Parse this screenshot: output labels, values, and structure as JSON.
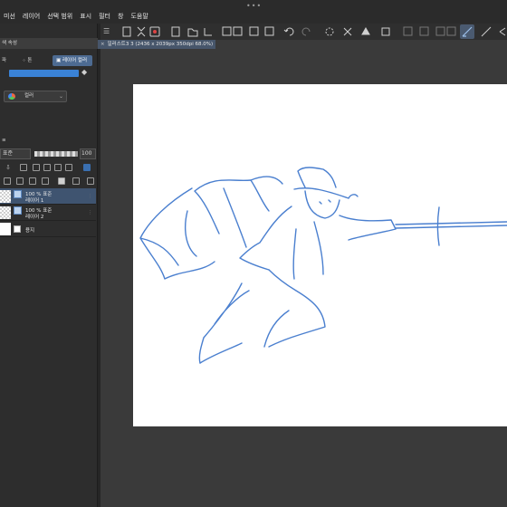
{
  "menubar": {
    "items": [
      "미선",
      "레이어",
      "선택 범위",
      "표시",
      "필터",
      "창",
      "도움말"
    ]
  },
  "window_controls": "•••",
  "left_panel": {
    "title": "색 속성",
    "tabs": [
      "파",
      "톤",
      "레이어 컬러"
    ],
    "dropdown_label": "컬러",
    "accent_color": "#3a82d6"
  },
  "layer_panel": {
    "blend_mode": "표준",
    "opacity": "100",
    "layers": [
      {
        "percent": "100 %",
        "mode": "표준",
        "name": "레이어 1",
        "selected": true
      },
      {
        "percent": "100 %",
        "mode": "표준",
        "name": "레이어 2",
        "selected": false
      },
      {
        "name": "용지",
        "paper": true
      }
    ]
  },
  "document_tab": {
    "title": "일러스트3 3 (2436 x 2039px 350dpi 68.0%)"
  },
  "canvas": {
    "background": "#ffffff",
    "stroke_color": "#4a7fcf"
  }
}
